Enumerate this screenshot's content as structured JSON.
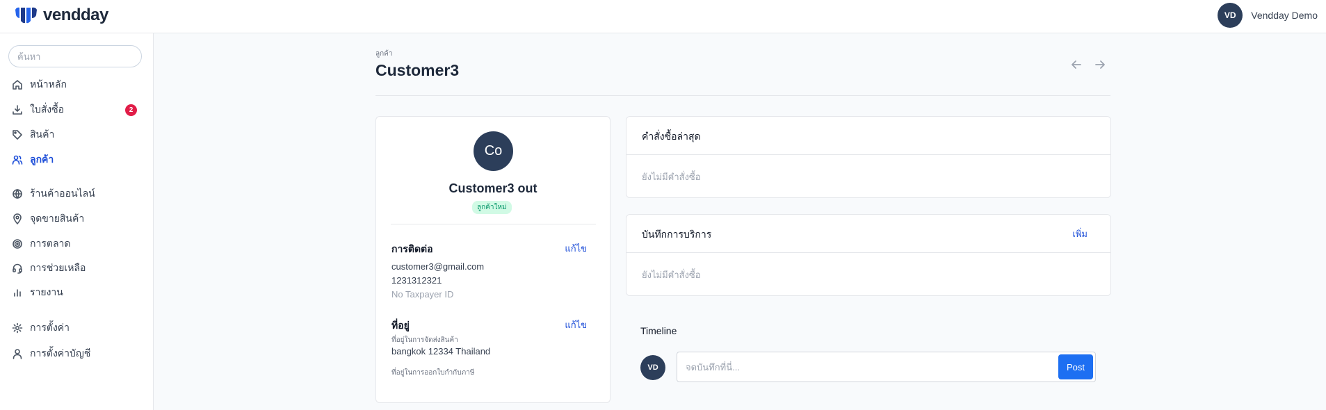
{
  "brand": {
    "name": "vendday",
    "accent": "#1d6ff2",
    "dark": "#2c3e5a"
  },
  "user": {
    "initials": "VD",
    "name": "Vendday Demo"
  },
  "sidebar": {
    "search_placeholder": "ค้นหา",
    "items": [
      {
        "label": "หน้าหลัก",
        "icon": "home-icon"
      },
      {
        "label": "ใบสั่งซื้อ",
        "icon": "download-icon",
        "badge": "2"
      },
      {
        "label": "สินค้า",
        "icon": "tag-icon"
      },
      {
        "label": "ลูกค้า",
        "icon": "users-icon",
        "active": true
      },
      {
        "label": "ร้านค้าออนไลน์",
        "icon": "globe-icon"
      },
      {
        "label": "จุดขายสินค้า",
        "icon": "map-pin-icon"
      },
      {
        "label": "การตลาด",
        "icon": "target-icon"
      },
      {
        "label": "การช่วยเหลือ",
        "icon": "headset-icon"
      },
      {
        "label": "รายงาน",
        "icon": "bar-chart-icon"
      },
      {
        "label": "การตั้งค่า",
        "icon": "gear-icon"
      },
      {
        "label": "การตั้งค่าบัญชี",
        "icon": "user-icon"
      }
    ]
  },
  "header": {
    "breadcrumb": "ลูกค้า",
    "title": "Customer3"
  },
  "profile": {
    "initials": "Co",
    "name": "Customer3 out",
    "tag": "ลูกค้าใหม่",
    "contact": {
      "title": "การติดต่อ",
      "edit": "แก้ไข",
      "email": "customer3@gmail.com",
      "phone": "1231312321",
      "tax": "No Taxpayer ID"
    },
    "address": {
      "title": "ที่อยู่",
      "edit": "แก้ไข",
      "shipping_label": "ที่อยู่ในการจัดส่งสินค้า",
      "shipping_value": "bangkok 12334 Thailand",
      "billing_label": "ที่อยู่ในการออกใบกำกับภาษี"
    }
  },
  "orders": {
    "title": "คำสั่งซื้อล่าสุด",
    "empty": "ยังไม่มีคำสั่งซื้อ"
  },
  "service": {
    "title": "บันทึกการบริการ",
    "add": "เพิ่ม",
    "empty": "ยังไม่มีคำสั่งซื้อ"
  },
  "timeline": {
    "title": "Timeline",
    "initials": "VD",
    "placeholder": "จดบันทึกที่นี่...",
    "post": "Post"
  }
}
